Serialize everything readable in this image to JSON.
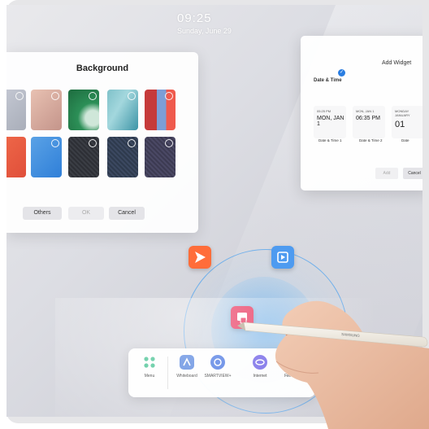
{
  "status": {
    "time": "09:25",
    "date": "Sunday, June 29"
  },
  "background_panel": {
    "title": "Background",
    "buttons": {
      "others": "Others",
      "ok": "OK",
      "cancel": "Cancel"
    }
  },
  "add_widget": {
    "title": "Add Widget",
    "section": "Date & Time",
    "cards": [
      {
        "line": "05:25 PM",
        "big": "MON, JAN 1",
        "label": "Date & Time 1"
      },
      {
        "line": "MON, JAN 1",
        "big": "06:35 PM",
        "label": "Date & Time 2"
      },
      {
        "line": "MONDAY JANUARY",
        "big": "01",
        "label": "Date"
      }
    ],
    "buttons": {
      "add": "Add",
      "cancel": "Cancel"
    }
  },
  "taskbar": {
    "items": [
      {
        "label": "Menu"
      },
      {
        "label": "Whiteboard"
      },
      {
        "label": "SMARTVIEW+"
      },
      {
        "label": "Internet"
      },
      {
        "label": "File Browser"
      }
    ]
  },
  "pen_brand": "SAMSUNG",
  "colors": {
    "accent_blue": "#2a7de1",
    "orange": "#ff6d3a",
    "pink": "#e8315a",
    "teal": "#3cbf8c"
  }
}
